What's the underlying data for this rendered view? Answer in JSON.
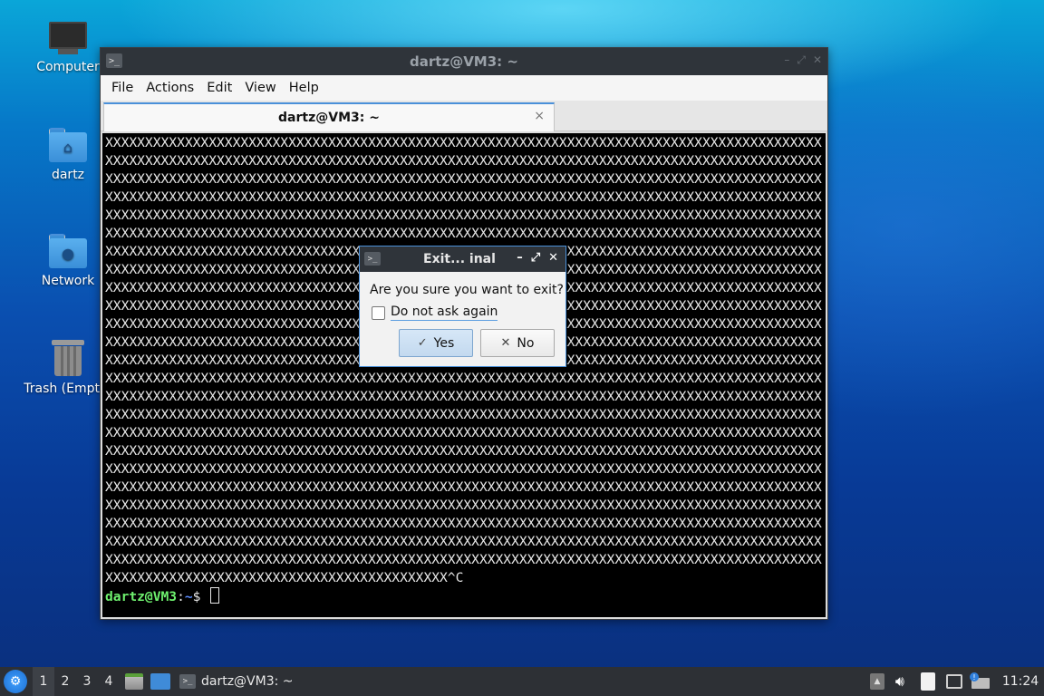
{
  "desktop": {
    "icons": [
      {
        "label": "Computer"
      },
      {
        "label": "dartz"
      },
      {
        "label": "Network"
      },
      {
        "label": "Trash (Empty)"
      }
    ]
  },
  "terminal_window": {
    "title": "dartz@VM3: ~",
    "icon": "terminal-icon",
    "title_buttons": [
      "minimize",
      "maximize",
      "close"
    ],
    "menu": [
      "File",
      "Actions",
      "Edit",
      "View",
      "Help"
    ],
    "tab": {
      "label": "dartz@VM3: ~",
      "close": "×"
    },
    "output_lines": [
      "XXXXXXXXXXXXXXXXXXXXXXXXXXXXXXXXXXXXXXXXXXXXXXXXXXXXXXXXXXXXXXXXXXXXXXXXXXXXXXXXXXXXXXXXXX",
      "XXXXXXXXXXXXXXXXXXXXXXXXXXXXXXXXXXXXXXXXXXXXXXXXXXXXXXXXXXXXXXXXXXXXXXXXXXXXXXXXXXXXXXXXXX",
      "XXXXXXXXXXXXXXXXXXXXXXXXXXXXXXXXXXXXXXXXXXXXXXXXXXXXXXXXXXXXXXXXXXXXXXXXXXXXXXXXXXXXXXXXXX",
      "XXXXXXXXXXXXXXXXXXXXXXXXXXXXXXXXXXXXXXXXXXXXXXXXXXXXXXXXXXXXXXXXXXXXXXXXXXXXXXXXXXXXXXXXXX",
      "XXXXXXXXXXXXXXXXXXXXXXXXXXXXXXXXXXXXXXXXXXXXXXXXXXXXXXXXXXXXXXXXXXXXXXXXXXXXXXXXXXXXXXXXXX",
      "XXXXXXXXXXXXXXXXXXXXXXXXXXXXXXXXXXXXXXXXXXXXXXXXXXXXXXXXXXXXXXXXXXXXXXXXXXXXXXXXXXXXXXXXXX",
      "XXXXXXXXXXXXXXXXXXXXXXXXXXXXXXXXXXXXXXXXXXXXXXXXXXXXXXXXXXXXXXXXXXXXXXXXXXXXXXXXXXXXXXXXXX",
      "XXXXXXXXXXXXXXXXXXXXXXXXXXXXXXXXXXXXXXXXXXXXXXXXXXXXXXXXXXXXXXXXXXXXXXXXXXXXXXXXXXXXXXXXXX",
      "XXXXXXXXXXXXXXXXXXXXXXXXXXXXXXXXXXXXXXXXXXXXXXXXXXXXXXXXXXXXXXXXXXXXXXXXXXXXXXXXXXXXXXXXXX",
      "XXXXXXXXXXXXXXXXXXXXXXXXXXXXXXXXXXXXXXXXXXXXXXXXXXXXXXXXXXXXXXXXXXXXXXXXXXXXXXXXXXXXXXXXXX",
      "XXXXXXXXXXXXXXXXXXXXXXXXXXXXXXXXXXXXXXXXXXXXXXXXXXXXXXXXXXXXXXXXXXXXXXXXXXXXXXXXXXXXXXXXXX",
      "XXXXXXXXXXXXXXXXXXXXXXXXXXXXXXXXXXXXXXXXXXXXXXXXXXXXXXXXXXXXXXXXXXXXXXXXXXXXXXXXXXXXXXXXXX",
      "XXXXXXXXXXXXXXXXXXXXXXXXXXXXXXXXXXXXXXXXXXXXXXXXXXXXXXXXXXXXXXXXXXXXXXXXXXXXXXXXXXXXXXXXXX",
      "XXXXXXXXXXXXXXXXXXXXXXXXXXXXXXXXXXXXXXXXXXXXXXXXXXXXXXXXXXXXXXXXXXXXXXXXXXXXXXXXXXXXXXXXXX",
      "XXXXXXXXXXXXXXXXXXXXXXXXXXXXXXXXXXXXXXXXXXXXXXXXXXXXXXXXXXXXXXXXXXXXXXXXXXXXXXXXXXXXXXXXXX",
      "XXXXXXXXXXXXXXXXXXXXXXXXXXXXXXXXXXXXXXXXXXXXXXXXXXXXXXXXXXXXXXXXXXXXXXXXXXXXXXXXXXXXXXXXXX",
      "XXXXXXXXXXXXXXXXXXXXXXXXXXXXXXXXXXXXXXXXXXXXXXXXXXXXXXXXXXXXXXXXXXXXXXXXXXXXXXXXXXXXXXXXXX",
      "XXXXXXXXXXXXXXXXXXXXXXXXXXXXXXXXXXXXXXXXXXXXXXXXXXXXXXXXXXXXXXXXXXXXXXXXXXXXXXXXXXXXXXXXXX",
      "XXXXXXXXXXXXXXXXXXXXXXXXXXXXXXXXXXXXXXXXXXXXXXXXXXXXXXXXXXXXXXXXXXXXXXXXXXXXXXXXXXXXXXXXXX",
      "XXXXXXXXXXXXXXXXXXXXXXXXXXXXXXXXXXXXXXXXXXXXXXXXXXXXXXXXXXXXXXXXXXXXXXXXXXXXXXXXXXXXXXXXXX",
      "XXXXXXXXXXXXXXXXXXXXXXXXXXXXXXXXXXXXXXXXXXXXXXXXXXXXXXXXXXXXXXXXXXXXXXXXXXXXXXXXXXXXXXXXXX",
      "XXXXXXXXXXXXXXXXXXXXXXXXXXXXXXXXXXXXXXXXXXXXXXXXXXXXXXXXXXXXXXXXXXXXXXXXXXXXXXXXXXXXXXXXXX",
      "XXXXXXXXXXXXXXXXXXXXXXXXXXXXXXXXXXXXXXXXXXXXXXXXXXXXXXXXXXXXXXXXXXXXXXXXXXXXXXXXXXXXXXXXXX",
      "XXXXXXXXXXXXXXXXXXXXXXXXXXXXXXXXXXXXXXXXXXXXXXXXXXXXXXXXXXXXXXXXXXXXXXXXXXXXXXXXXXXXXXXXXX",
      "XXXXXXXXXXXXXXXXXXXXXXXXXXXXXXXXXXXXXXXXXXX^C"
    ],
    "prompt": {
      "user_host": "dartz@VM3",
      "sep": ":",
      "path": "~",
      "symbol": "$ "
    }
  },
  "dialog": {
    "title": "Exit...  inal",
    "message": "Are you sure you want to exit?",
    "checkbox_label": "Do not ask again",
    "checkbox_checked": false,
    "yes_label": "Yes",
    "no_label": "No",
    "yes_icon": "✓",
    "no_icon": "✕",
    "title_buttons": [
      "–",
      "⤢",
      "✕"
    ]
  },
  "taskbar": {
    "workspaces": [
      "1",
      "2",
      "3",
      "4"
    ],
    "active_workspace": "1",
    "task_label": "dartz@VM3: ~",
    "clock": "11:24"
  }
}
